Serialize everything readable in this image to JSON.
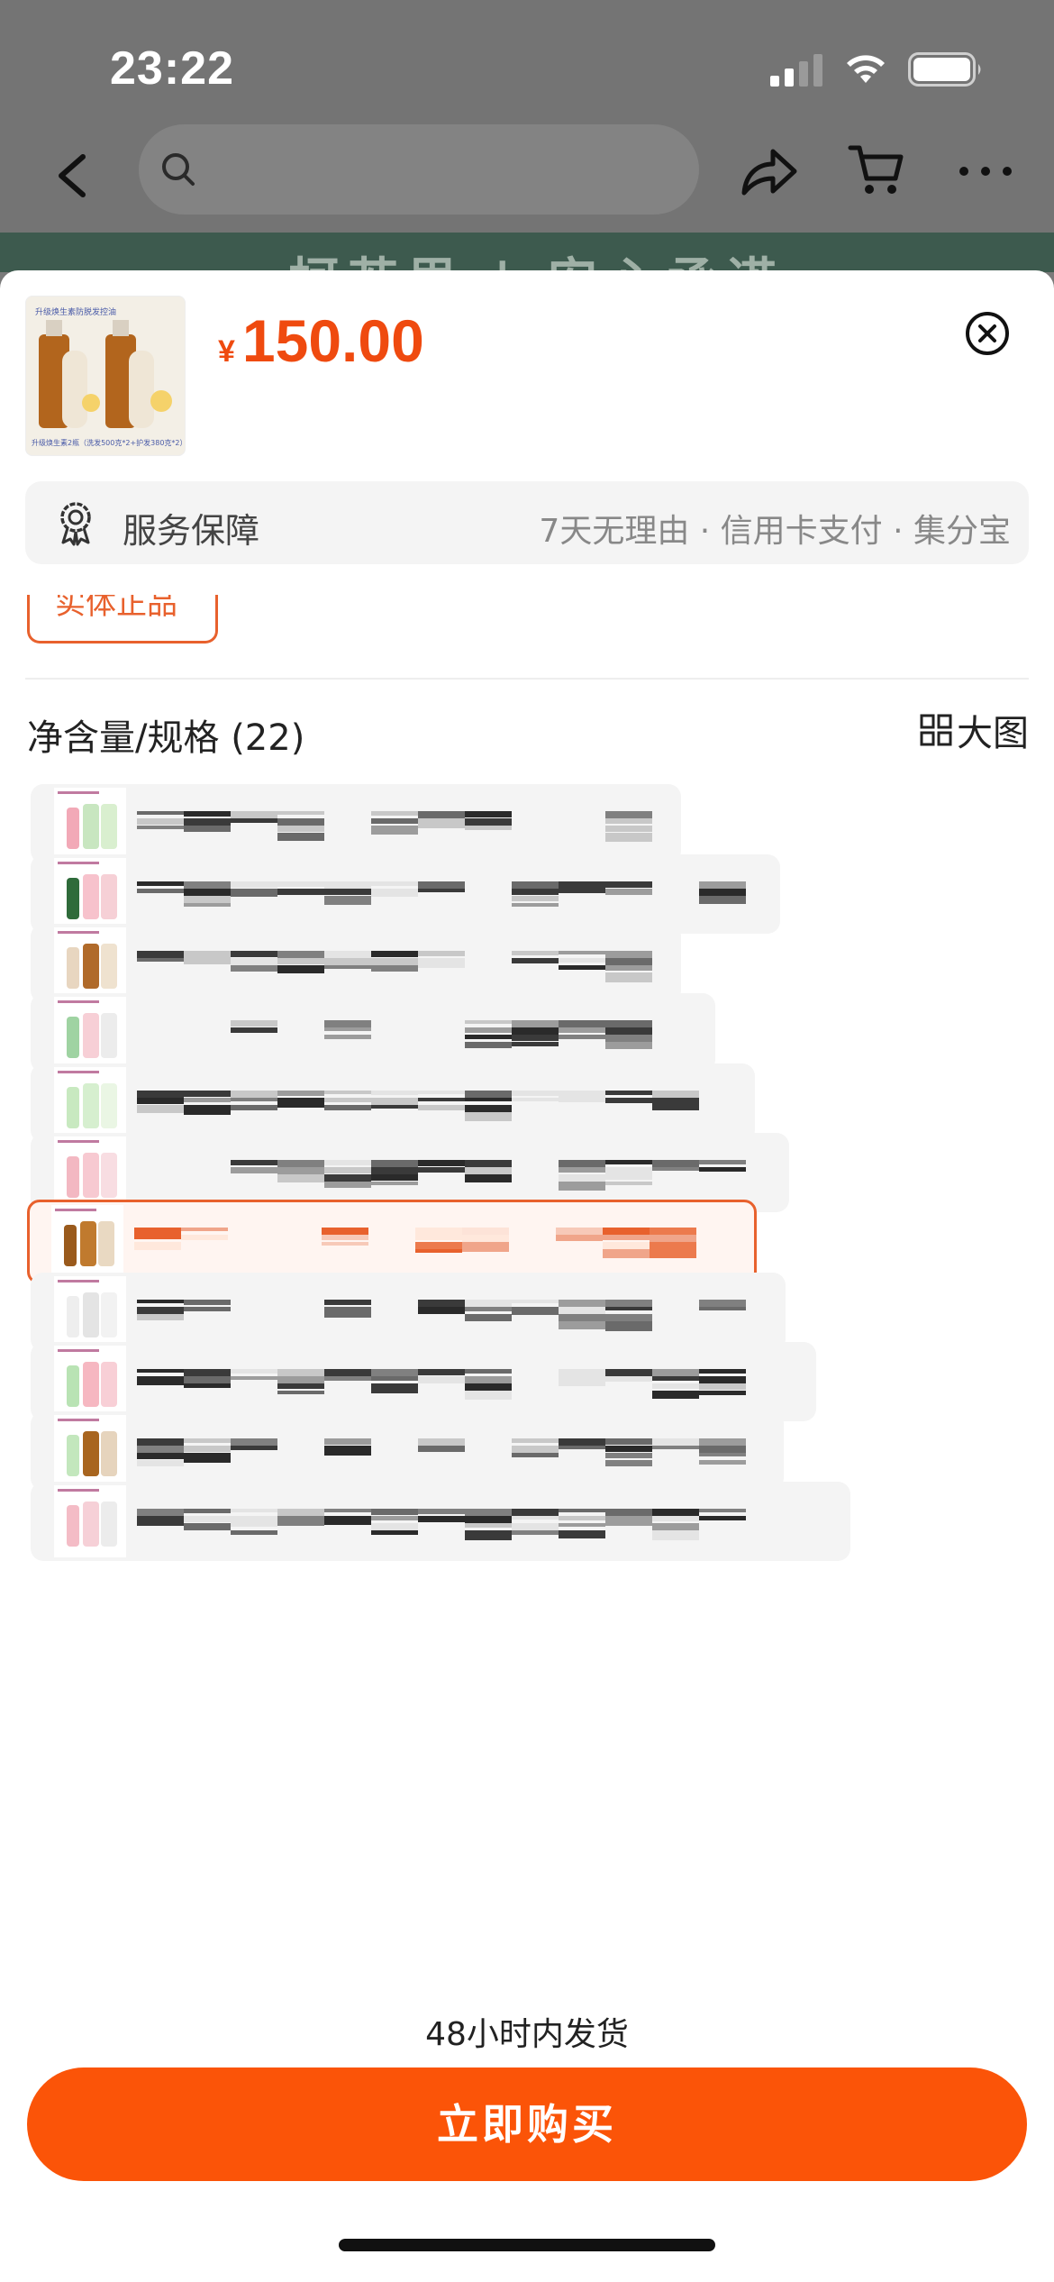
{
  "status_bar": {
    "time": "23:22"
  },
  "nav": {
    "back_icon": "chevron-left-icon",
    "search_icon": "search-icon",
    "share_icon": "share-icon",
    "cart_icon": "cart-icon",
    "more_icon": "more-icon"
  },
  "product": {
    "currency": "¥",
    "price": "150.00",
    "thumb_caption_top": "升级焕生素防脱发控油",
    "thumb_caption_bottom": "升级焕生素2瓶（洗发500克*2+护发380克*2）"
  },
  "service": {
    "label": "服务保障",
    "detail": "7天无理由 · 信用卡支付 · 集分宝"
  },
  "partial_tag": "实体正品",
  "spec": {
    "title": "净含量/规格 (22)",
    "big_pic_label": "大图",
    "options": [
      {
        "selected": false,
        "thumb": [
          "#f2a9b7",
          "#c8e6c0",
          "#d9efcf"
        ]
      },
      {
        "selected": false,
        "thumb": [
          "#2f6b3a",
          "#f7c2cc",
          "#f6d0d6"
        ]
      },
      {
        "selected": false,
        "thumb": [
          "#e8d6c0",
          "#b06a2a",
          "#efe2cf"
        ]
      },
      {
        "selected": false,
        "thumb": [
          "#9fd3a2",
          "#f7cfd6",
          "#ececec"
        ]
      },
      {
        "selected": false,
        "thumb": [
          "#c8e9c0",
          "#d6efcf",
          "#eaf6e4"
        ]
      },
      {
        "selected": false,
        "thumb": [
          "#f3b8c2",
          "#f7c9d1",
          "#f8dde2"
        ]
      },
      {
        "selected": true,
        "thumb": [
          "#9a5a1c",
          "#c07a2e",
          "#e9d9c2"
        ]
      },
      {
        "selected": false,
        "thumb": [
          "#eeeeee",
          "#e4e4e4",
          "#f2f2f2"
        ]
      },
      {
        "selected": false,
        "thumb": [
          "#b9e3b4",
          "#f6b7c1",
          "#f8cfd6"
        ]
      },
      {
        "selected": false,
        "thumb": [
          "#c3e7bd",
          "#a8651f",
          "#e6d4bd"
        ]
      },
      {
        "selected": false,
        "thumb": [
          "#f4bcc6",
          "#f6d0d7",
          "#ececec"
        ]
      }
    ]
  },
  "delivery": "48小时内发货",
  "buy_button": "立即购买",
  "colors": {
    "accent": "#fb5408",
    "price": "#ef4a0f",
    "selected_border": "#e8612d"
  }
}
